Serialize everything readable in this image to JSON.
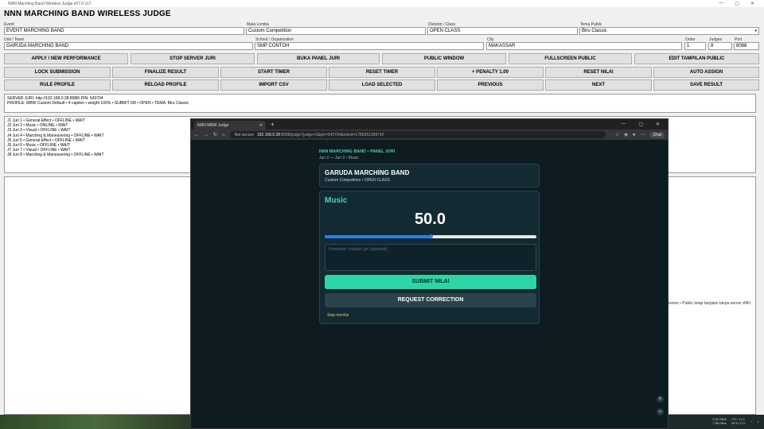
{
  "window": {
    "caption": "NNN Marching Band Wireless Judge v67.0 v17",
    "controls": [
      "—",
      "▢",
      "✕"
    ]
  },
  "app_title": "NNN MARCHING BAND WIRELESS JUDGE",
  "form": {
    "event": {
      "label": "Event",
      "value": "EVENT MARCHING BAND"
    },
    "mata_lomba": {
      "label": "Mata Lomba",
      "value": "Custom Competition"
    },
    "division": {
      "label": "Division / Class",
      "value": "OPEN CLASS"
    },
    "tema": {
      "label": "Tema Public",
      "value": "Biru Classic"
    },
    "unit": {
      "label": "Unit / Team",
      "value": "GARUDA MARCHING BAND"
    },
    "school": {
      "label": "School / Organization",
      "value": "SMP CONTOH"
    },
    "city": {
      "label": "City",
      "value": "MAKASSAR"
    },
    "order": {
      "label": "Order",
      "value": "1"
    },
    "judges": {
      "label": "Judges",
      "value": "8"
    },
    "port": {
      "label": "Port",
      "value": "8088"
    }
  },
  "buttons_row1": [
    "APPLY / NEW PERFORMANCE",
    "STOP SERVER JURI",
    "BUKA PANEL JURI",
    "PUBLIC WINDOW",
    "FULLSCREEN PUBLIC",
    "EDIT TAMPILAN PUBLIC"
  ],
  "buttons_row2": [
    "LOCK SUBMISSION",
    "FINALIZE RESULT",
    "START TIMER",
    "RESET TIMER",
    "+ PENALTY 1.00",
    "RESET NILAI",
    "AUTO ASSIGN"
  ],
  "buttons_row3": [
    "RULE PROFILE",
    "RELOAD PROFILE",
    "IMPORT CSV",
    "LOAD SELECTED",
    "PREVIOUS",
    "NEXT",
    "SAVE RESULT"
  ],
  "info": {
    "line1": "SERVER JURI: http://192.168.0.28:8088/    PIN: 543704",
    "line2": "PROFILE: MBW Custom Default • 4 caption • weight 100%    •    SUBMIT 0/8    •    OPEN    •    TEMA: Biru Classic"
  },
  "judges_list": [
    "J1  Juri 1  •  General Effect  •  OFFLINE  •  WAIT",
    "J2  Juri 2  •  Music  •  ONLINE  •  WAIT",
    "J3  Juri 3  •  Visual  •  OFFLINE  •  WAIT",
    "J4  Juri 4  •  Marching & Maneuvering  •  OFFLINE  •  WAIT",
    "J5  Juri 5  •  General Effect  •  OFFLINE  •  WAIT",
    "J6  Juri 6  •  Music  •  OFFLINE  •  WAIT",
    "J7  Juri 7  •  Visual  •  OFFLINE  •  WAIT",
    "J8  Juri 8  •  Marching & Maneuvering  •  OFFLINE  •  WAIT"
  ],
  "side_note": "eview  •  Public tetap berjalan tanpa server WiFi.",
  "browser": {
    "tab_title": "NNN MBW Judge",
    "not_secure": "Not secure",
    "url_host": "192.168.0.28",
    "url_path": ":8088/judge?judge=2&pin=543704&client=1786351998742",
    "chat": "Chat"
  },
  "judge_page": {
    "header": "NNN MARCHING BAND • PANEL JURI",
    "sub": "Juri 2 — Juri 2 • Music",
    "band": "GARUDA MARCHING BAND",
    "band_sub": "Custom Competition • OPEN CLASS",
    "caption": "Music",
    "score": "50.0",
    "slider_fraction": 0.5,
    "comment_placeholder": "Komentar / catatan juri (opsional)",
    "submit_label": "SUBMIT NILAI",
    "request_label": "REQUEST CORRECTION",
    "status": "Siap menilai"
  },
  "tray": {
    "net": "0.51 KB/s",
    "net2": "7.56 KB/s",
    "cpu": "CPU 11%",
    "mem": "MEM 32%"
  },
  "colors": {
    "accent": "#4fd3b8",
    "submit": "#2dd4a6",
    "slider": "#2b7de9",
    "status": "#d9c96a"
  }
}
